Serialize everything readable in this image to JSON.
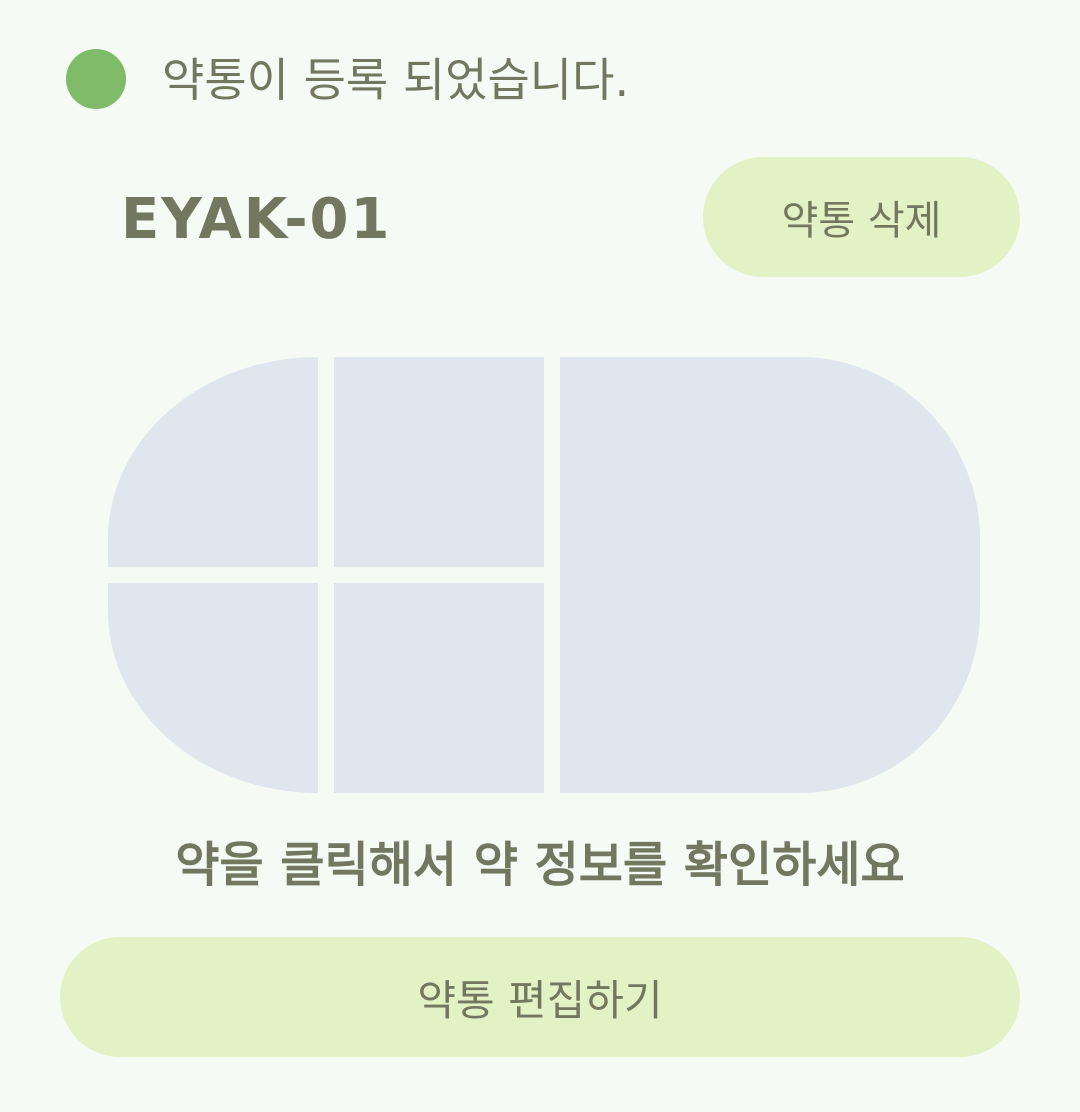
{
  "status": {
    "icon": "status-dot-icon",
    "color": "#80bb69",
    "text": "약통이 등록 되었습니다."
  },
  "device": {
    "id": "EYAK-01"
  },
  "actions": {
    "delete_label": "약통 삭제",
    "edit_label": "약통 편집하기"
  },
  "pillbox": {
    "compartments": [
      "top-left",
      "bottom-left",
      "top-middle",
      "bottom-middle",
      "right"
    ],
    "compartment_color": "#dfe6ee"
  },
  "hint": "약을 클릭해서 약 정보를 확인하세요",
  "colors": {
    "background": "#f5faf5",
    "button": "#e3f2c4",
    "text": "#737760"
  }
}
